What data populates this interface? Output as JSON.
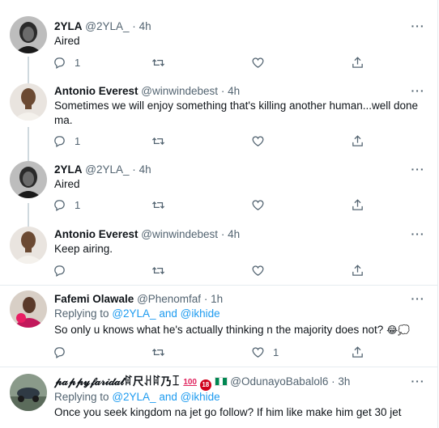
{
  "tweets": [
    {
      "name": "2YLA",
      "handle": "@2YLA_",
      "dot": "·",
      "time": "4h",
      "text": "Aired",
      "reply_count": "1",
      "retweet_count": "",
      "like_count": ""
    },
    {
      "name": "Antonio Everest",
      "handle": "@winwindebest",
      "dot": "·",
      "time": "4h",
      "text": "Sometimes we will enjoy something that's killing another human...well done ma.",
      "reply_count": "1",
      "retweet_count": "",
      "like_count": ""
    },
    {
      "name": "2YLA",
      "handle": "@2YLA_",
      "dot": "·",
      "time": "4h",
      "text": "Aired",
      "reply_count": "1",
      "retweet_count": "",
      "like_count": ""
    },
    {
      "name": "Antonio Everest",
      "handle": "@winwindebest",
      "dot": "·",
      "time": "4h",
      "text": "Keep airing.",
      "reply_count": "",
      "retweet_count": "",
      "like_count": ""
    },
    {
      "name": "Fafemi Olawale",
      "handle": "@Phenomfaf",
      "dot": "·",
      "time": "1h",
      "replying_prefix": "Replying to",
      "replying_user1": "@2YLA_",
      "replying_and": "and",
      "replying_user2": "@ikhide",
      "text": "So only u knows what he's actually thinking n the majority does not?",
      "text_emoji": "😂💭",
      "reply_count": "",
      "retweet_count": "",
      "like_count": "1"
    },
    {
      "name": "𝓅𝒶𝓅𝓅𝓎𝒻𝒶𝓇𝒾𝒹𝒶𝓉ꍏ尺ꃅꍏ乃ꀤ",
      "handle": "@OdunayoBabalol6",
      "dot": "·",
      "time": "3h",
      "replying_prefix": "Replying to",
      "replying_user1": "@2YLA_",
      "replying_and": "and",
      "replying_user2": "@ikhide",
      "text": "Once you seek kingdom na jet go follow? If him like make him get 30 jet"
    }
  ],
  "icons": {
    "reply": "reply-icon",
    "retweet": "retweet-icon",
    "like": "heart-icon",
    "share": "share-icon",
    "more": "more-icon"
  },
  "colors": {
    "link": "#1d9bf0",
    "secondary": "#536471",
    "divider": "#e6ecf0"
  }
}
